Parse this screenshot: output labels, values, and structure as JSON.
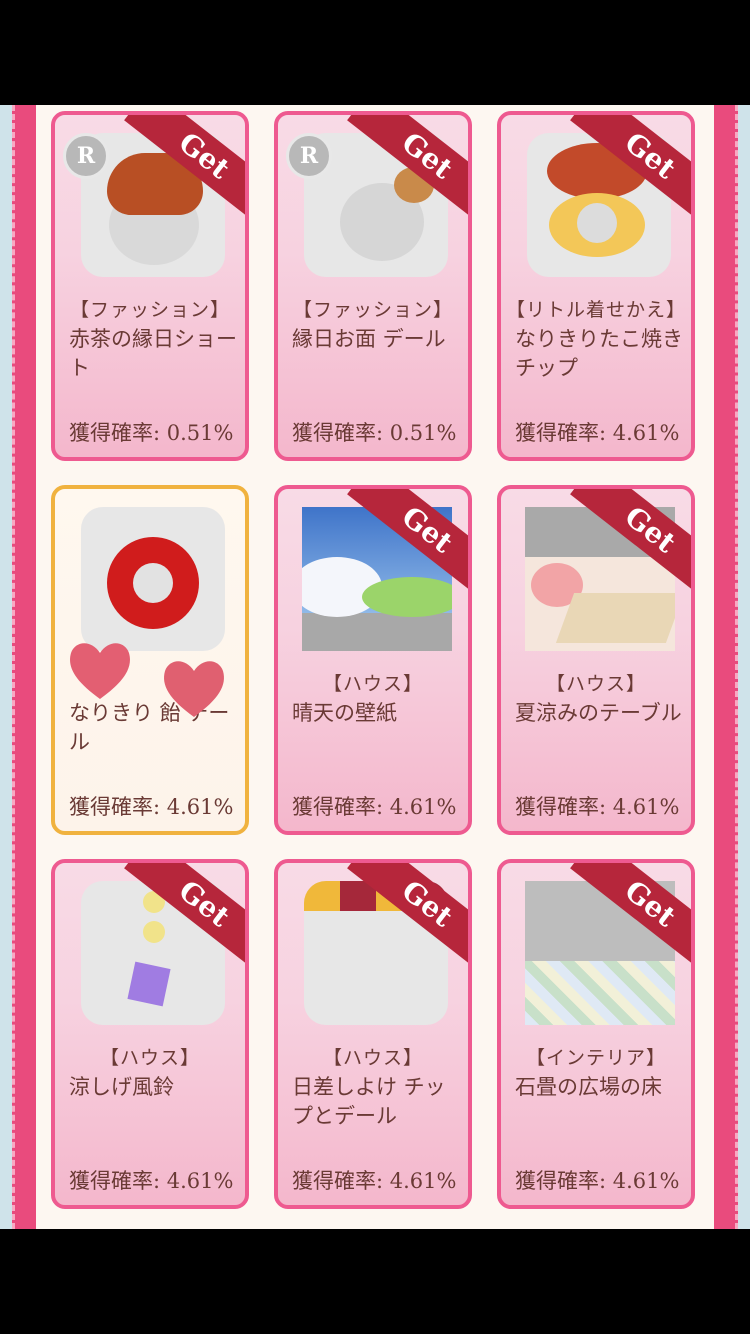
{
  "ribbon_label": "Get",
  "rarity_badge": "R",
  "items": [
    {
      "category": "【ファッション】",
      "name": "赤茶の縁日ショート",
      "rate": "獲得確率: 0.51%",
      "get": true,
      "rare": true
    },
    {
      "category": "【ファッション】",
      "name": "縁日お面 デール",
      "rate": "獲得確率: 0.51%",
      "get": true,
      "rare": true
    },
    {
      "category": "【リトル着せかえ】",
      "name": "なりきりたこ焼き チップ",
      "rate": "獲得確率: 4.61%",
      "get": true,
      "rare": false
    },
    {
      "category": "",
      "name": "なりきり 飴 デール",
      "rate": "獲得確率: 4.61%",
      "get": false,
      "rare": false
    },
    {
      "category": "【ハウス】",
      "name": "晴天の壁紙",
      "rate": "獲得確率: 4.61%",
      "get": true,
      "rare": false
    },
    {
      "category": "【ハウス】",
      "name": "夏涼みのテーブル",
      "rate": "獲得確率: 4.61%",
      "get": true,
      "rare": false
    },
    {
      "category": "【ハウス】",
      "name": "涼しげ風鈴",
      "rate": "獲得確率: 4.61%",
      "get": true,
      "rare": false
    },
    {
      "category": "【ハウス】",
      "name": "日差しよけ チップとデール",
      "rate": "獲得確率: 4.61%",
      "get": true,
      "rare": false
    },
    {
      "category": "【インテリア】",
      "name": "石畳の広場の床",
      "rate": "獲得確率: 4.61%",
      "get": true,
      "rare": false
    }
  ]
}
